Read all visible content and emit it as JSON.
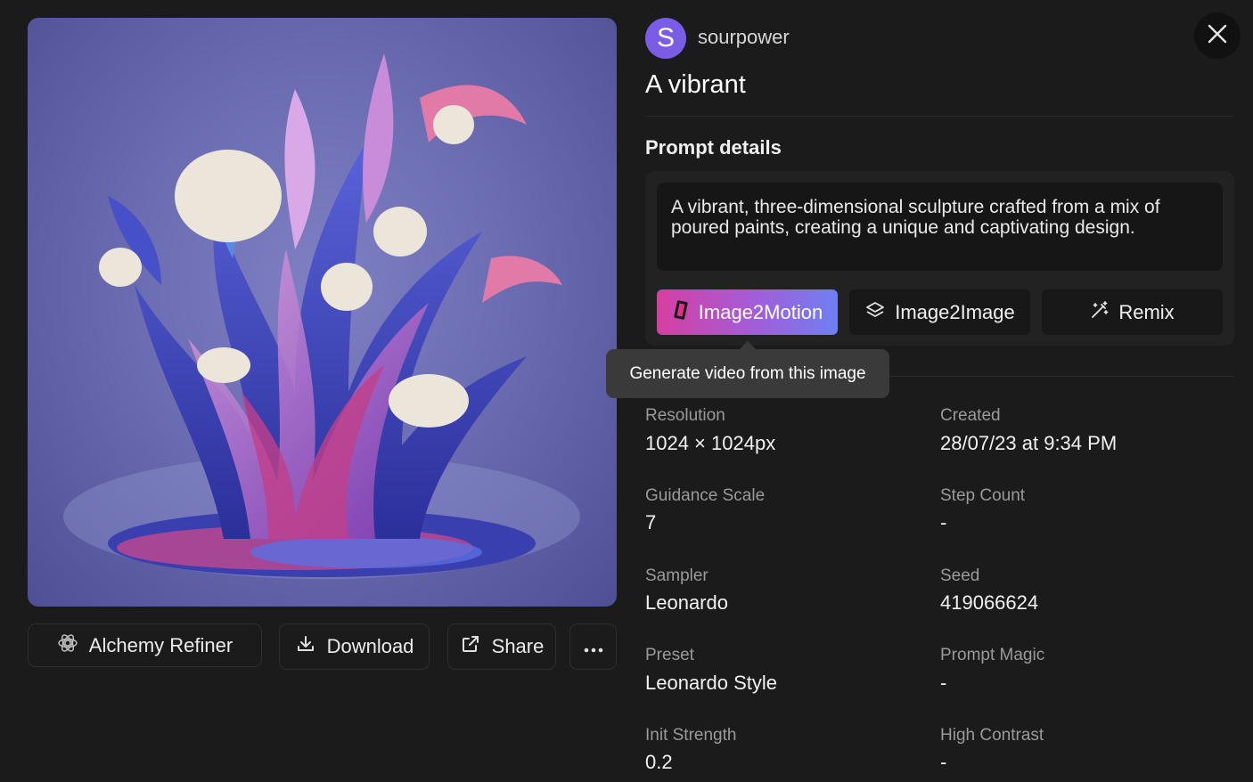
{
  "user": {
    "avatar_letter": "S",
    "name": "sourpower"
  },
  "title": "A vibrant",
  "prompt_section": {
    "label": "Prompt details",
    "prompt": "A vibrant, three-dimensional sculpture crafted from a mix of poured paints, creating a unique and captivating design.",
    "buttons": {
      "image2motion": "Image2Motion",
      "image2image": "Image2Image",
      "remix": "Remix"
    },
    "tooltip": "Generate video from this image"
  },
  "image_actions": {
    "alchemy": "Alchemy Refiner",
    "download": "Download",
    "share": "Share"
  },
  "details": {
    "resolution": {
      "label": "Resolution",
      "value": "1024 × 1024px"
    },
    "created": {
      "label": "Created",
      "value": "28/07/23 at 9:34 PM"
    },
    "guidance": {
      "label": "Guidance Scale",
      "value": "7"
    },
    "steps": {
      "label": "Step Count",
      "value": "-"
    },
    "sampler": {
      "label": "Sampler",
      "value": "Leonardo"
    },
    "seed": {
      "label": "Seed",
      "value": "419066624"
    },
    "preset": {
      "label": "Preset",
      "value": "Leonardo Style"
    },
    "prompt_magic": {
      "label": "Prompt Magic",
      "value": "-"
    },
    "init_strength": {
      "label": "Init Strength",
      "value": "0.2"
    },
    "high_contrast": {
      "label": "High Contrast",
      "value": "-"
    }
  },
  "colors": {
    "background": "#1b1b1b",
    "avatar": "#7a5ce6",
    "motion_gradient_start": "#d63fa0",
    "motion_gradient_end": "#6f7ff3"
  },
  "icons": [
    "alchemy-icon",
    "download-icon",
    "share-icon",
    "more-icon",
    "close-icon",
    "film-icon",
    "layers-icon",
    "magic-wand-icon"
  ]
}
